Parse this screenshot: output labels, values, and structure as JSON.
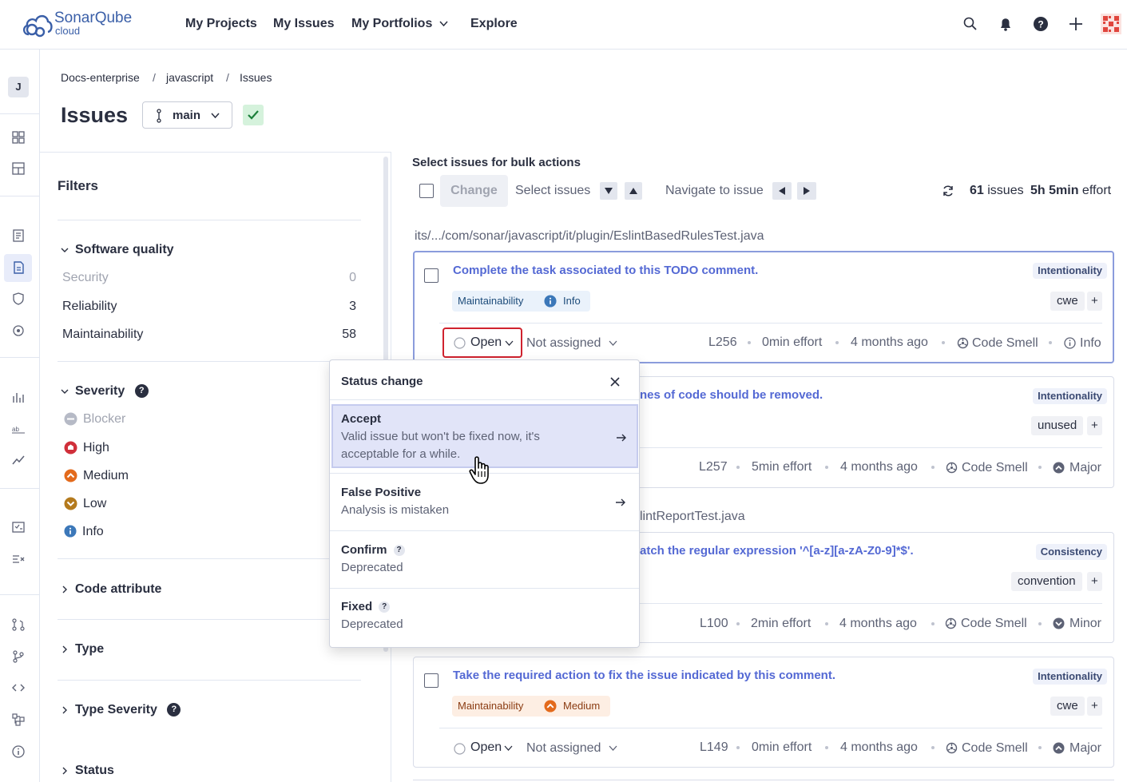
{
  "brand": {
    "name": "SonarQube",
    "sub": "cloud",
    "color": "#3a5fa8"
  },
  "nav": {
    "projects": "My Projects",
    "issues": "My Issues",
    "portfolios": "My Portfolios",
    "explore": "Explore"
  },
  "sidebar": {
    "avatar": "J"
  },
  "breadcrumb": {
    "org": "Docs-enterprise",
    "sep1": "/",
    "project": "javascript",
    "sep2": "/",
    "page": "Issues"
  },
  "page": {
    "title": "Issues",
    "branch": "main"
  },
  "filters": {
    "title": "Filters",
    "software_quality": {
      "label": "Software quality",
      "items": [
        {
          "label": "Security",
          "count": "0"
        },
        {
          "label": "Reliability",
          "count": "3"
        },
        {
          "label": "Maintainability",
          "count": "58"
        }
      ]
    },
    "severity": {
      "label": "Severity",
      "help": "?",
      "items": [
        {
          "label": "Blocker",
          "color": "#b6bac6"
        },
        {
          "label": "High",
          "color": "#d02f3a"
        },
        {
          "label": "Medium",
          "color": "#e36a1c"
        },
        {
          "label": "Low",
          "color": "#b47a1d"
        },
        {
          "label": "Info",
          "color": "#3c78b9"
        }
      ]
    },
    "code_attribute": "Code attribute",
    "type": "Type",
    "type_severity": "Type Severity",
    "status": "Status"
  },
  "bulk": {
    "title": "Select issues for bulk actions",
    "change": "Change",
    "select_issues": "Select issues",
    "navigate": "Navigate to issue",
    "issue_count": "61",
    "issues_label": "issues",
    "effort": "5h 5min",
    "effort_label": "effort"
  },
  "file1": "its/.../com/sonar/javascript/it/plugin/EslintBasedRulesTest.java",
  "file2_partial": "lintReportTest.java",
  "issues": [
    {
      "title": "Complete the task associated to this TODO comment.",
      "attribute": "Intentionality",
      "quality": "Maintainability",
      "severity": "Info",
      "tag": "cwe",
      "status": "Open",
      "assignee": "Not assigned",
      "line": "L256",
      "effort": "0min effort",
      "age": "4 months ago",
      "type": "Code Smell",
      "type_sev": "Info"
    },
    {
      "title": "nes of code should be removed.",
      "attribute": "Intentionality",
      "tag": "unused",
      "line": "L257",
      "effort": "5min effort",
      "age": "4 months ago",
      "type": "Code Smell",
      "type_sev": "Major"
    },
    {
      "title": "atch the regular expression '^[a-z][a-zA-Z0-9]*$'.",
      "attribute": "Consistency",
      "tag": "convention",
      "line": "L100",
      "effort": "2min effort",
      "age": "4 months ago",
      "type": "Code Smell",
      "type_sev": "Minor"
    },
    {
      "title": "Take the required action to fix the issue indicated by this comment.",
      "attribute": "Intentionality",
      "quality": "Maintainability",
      "severity": "Medium",
      "tag": "cwe",
      "status": "Open",
      "assignee": "Not assigned",
      "line": "L149",
      "effort": "0min effort",
      "age": "4 months ago",
      "type": "Code Smell",
      "type_sev": "Major"
    }
  ],
  "tag_add": "+",
  "popup": {
    "title": "Status change",
    "options": [
      {
        "title": "Accept",
        "desc1": "Valid issue but won't be fixed now, it's",
        "desc2": "acceptable for a while."
      },
      {
        "title": "False Positive",
        "desc1": "Analysis is mistaken"
      },
      {
        "title": "Confirm",
        "desc1": "Deprecated",
        "help": "?"
      },
      {
        "title": "Fixed",
        "desc1": "Deprecated",
        "help": "?"
      }
    ]
  }
}
